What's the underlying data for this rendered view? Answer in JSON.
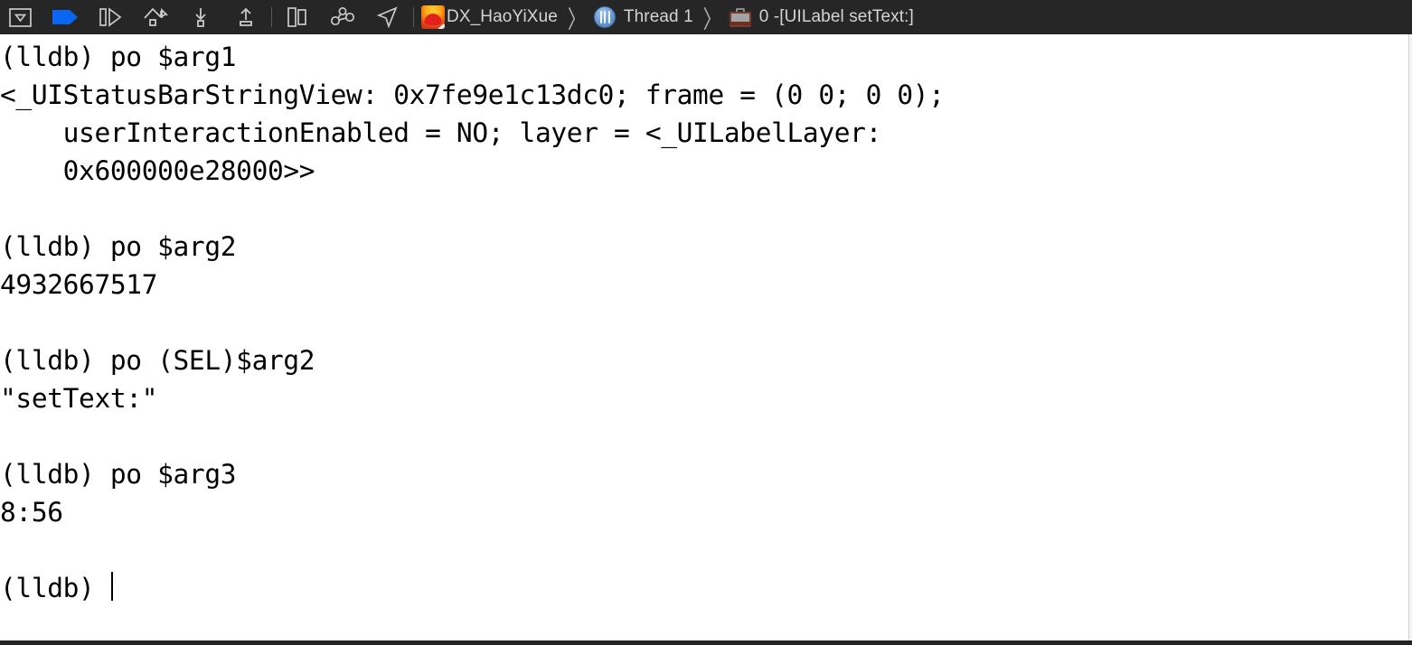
{
  "toolbar": {
    "buttons": [
      {
        "name": "hide-console-button",
        "icon": "panel-collapse-icon",
        "tooltip": "Hide/Show Debug Area"
      },
      {
        "name": "continue-button",
        "icon": "continue-program-icon",
        "tooltip": "Continue program execution"
      },
      {
        "name": "step-over-alt-button",
        "icon": "step-play-icon",
        "tooltip": "Step"
      },
      {
        "name": "step-over-button",
        "icon": "step-over-icon",
        "tooltip": "Step over"
      },
      {
        "name": "step-into-button",
        "icon": "step-into-icon",
        "tooltip": "Step into"
      },
      {
        "name": "step-out-button",
        "icon": "step-out-icon",
        "tooltip": "Step out"
      },
      {
        "name": "debug-view-button",
        "icon": "view-debugging-icon",
        "tooltip": "Debug View Hierarchy"
      },
      {
        "name": "memory-graph-button",
        "icon": "memory-graph-icon",
        "tooltip": "Debug Memory Graph"
      },
      {
        "name": "location-button",
        "icon": "simulate-location-icon",
        "tooltip": "Simulate Location"
      }
    ],
    "breadcrumb": [
      {
        "label": "DX_HaoYiXue",
        "icon": "app-icon"
      },
      {
        "label": "Thread 1",
        "icon": "thread-icon"
      },
      {
        "label": "0 -[UILabel setText:]",
        "icon": "frame-icon"
      }
    ],
    "separator_glyph": "〉",
    "background_color": "#262626",
    "text_color": "#d4d4d4",
    "accent_color": "#0a66ef"
  },
  "console": {
    "name": "lldb-console-output",
    "prompt": "(lldb) ",
    "background_color": "#ffffff",
    "text_color": "#000000",
    "lines": [
      "(lldb) po $arg1",
      "<_UIStatusBarStringView: 0x7fe9e1c13dc0; frame = (0 0; 0 0);",
      "    userInteractionEnabled = NO; layer = <_UILabelLayer:",
      "    0x600000e28000>>",
      "",
      "(lldb) po $arg2",
      "4932667517",
      "",
      "(lldb) po (SEL)$arg2",
      "\"setText:\"",
      "",
      "(lldb) po $arg3",
      "8:56",
      "",
      "(lldb) "
    ],
    "full_text": "(lldb) po $arg1\n<_UIStatusBarStringView: 0x7fe9e1c13dc0; frame = (0 0; 0 0);\n    userInteractionEnabled = NO; layer = <_UILabelLayer:\n    0x600000e28000>>\n\n(lldb) po $arg2\n4932667517\n\n(lldb) po (SEL)$arg2\n\"setText:\"\n\n(lldb) po $arg3\n8:56\n\n(lldb) ",
    "commands": [
      {
        "command": "po $arg1",
        "result": "<_UIStatusBarStringView: 0x7fe9e1c13dc0; frame = (0 0; 0 0); userInteractionEnabled = NO; layer = <_UILabelLayer: 0x600000e28000>>"
      },
      {
        "command": "po $arg2",
        "result": "4932667517"
      },
      {
        "command": "po (SEL)$arg2",
        "result": "\"setText:\""
      },
      {
        "command": "po $arg3",
        "result": "8:56"
      }
    ]
  }
}
